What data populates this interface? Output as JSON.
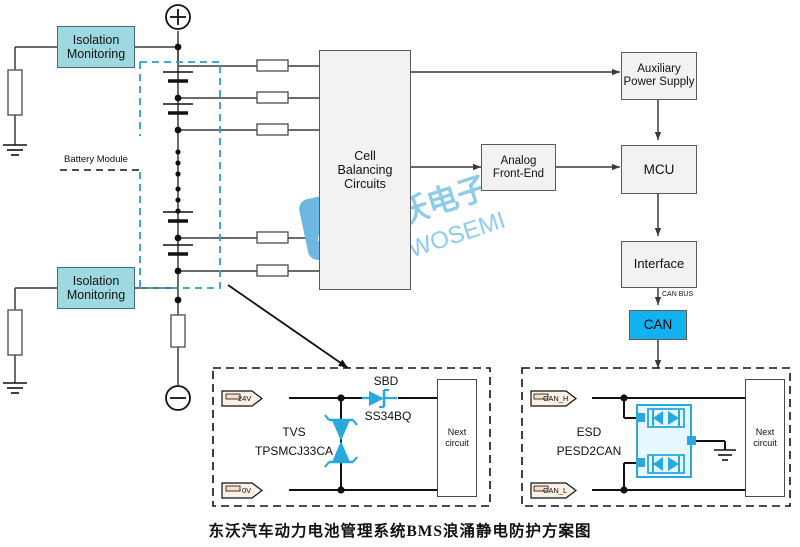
{
  "diagram": {
    "title": "东沃汽车动力电池管理系统BMS浪涌静电防护方案图",
    "accent_cyan": "#9ed9e2",
    "accent_can": "#11b2ef",
    "accent_component": "#29a8e0",
    "module_dash_color": "#2a9fd8"
  },
  "watermark": {
    "chinese": "东沃电子",
    "english": "DOWOSEMI"
  },
  "isolation": {
    "top_line1": "Isolation",
    "top_line2": "Monitoring",
    "bottom_line1": "Isolation",
    "bottom_line2": "Monitoring"
  },
  "battery": {
    "module_label": "Battery Module",
    "plus_terminal": "+",
    "minus_terminal": "−",
    "vertical_dots": "⋮"
  },
  "blocks": {
    "cell_balancing_l1": "Cell",
    "cell_balancing_l2": "Balancing",
    "cell_balancing_l3": "Circuits",
    "analog_front_end_l1": "Analog",
    "analog_front_end_l2": "Front-End",
    "aux_power_l1": "Auxiliary",
    "aux_power_l2": "Power Supply",
    "mcu": "MCU",
    "interface": "Interface",
    "can": "CAN",
    "can_bus_label": "CAN BUS"
  },
  "detail_tvs": {
    "pin_high": "24V",
    "pin_low": "0V",
    "tvs_label_l1": "TVS",
    "tvs_label_l2": "TPSMCJ33CA",
    "sbd_label": "SBD",
    "sbd_part": "SS34BQ",
    "next_l1": "Next",
    "next_l2": "circuit"
  },
  "detail_esd": {
    "pin_high": "CAN_H",
    "pin_low": "CAN_L",
    "esd_label_l1": "ESD",
    "esd_label_l2": "PESD2CAN",
    "next_l1": "Next",
    "next_l2": "circuit"
  }
}
